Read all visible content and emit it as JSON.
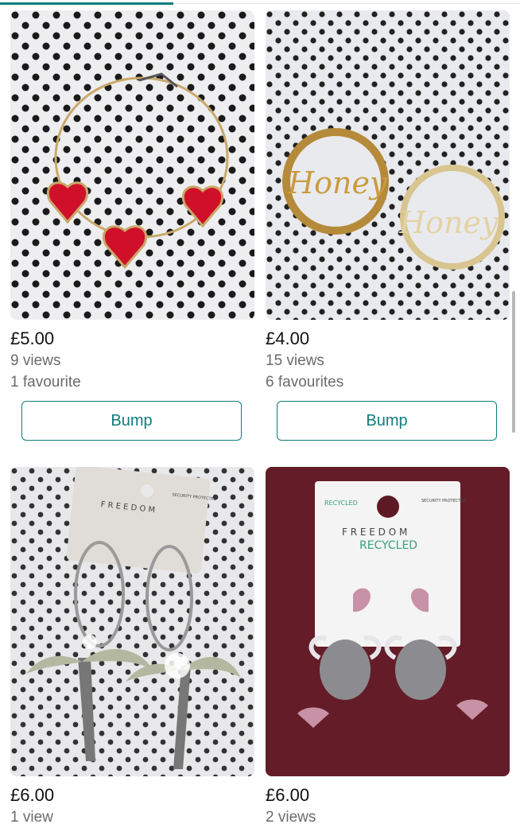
{
  "listings": [
    {
      "price": "£5.00",
      "views": "9 views",
      "favourites": "1 favourite",
      "bump_label": "Bump",
      "photo": "red heart hoop earring on polka dot background"
    },
    {
      "price": "£4.00",
      "views": "15 views",
      "favourites": "6 favourites",
      "bump_label": "Bump",
      "photo": "gold Honey nameplate hoop earrings",
      "photo_text": "Honey"
    },
    {
      "price": "£6.00",
      "views": "1 view",
      "photo": "silver palm tree hoop earrings on Freedom card",
      "card_brand": "F R E E D O M",
      "card_tag": "SECURITY PROTECTED"
    },
    {
      "price": "£6.00",
      "views": "2 views",
      "photo": "scorpion drop earrings on Freedom Recycled card",
      "card_brand": "F R E E D O M",
      "card_sub": "RECYCLED",
      "card_badge": "RECYCLED",
      "card_tag": "SECURITY PROTECTED"
    }
  ],
  "colors": {
    "accent": "#0f7c7c",
    "price": "#111111",
    "meta": "#6b6b6b"
  }
}
